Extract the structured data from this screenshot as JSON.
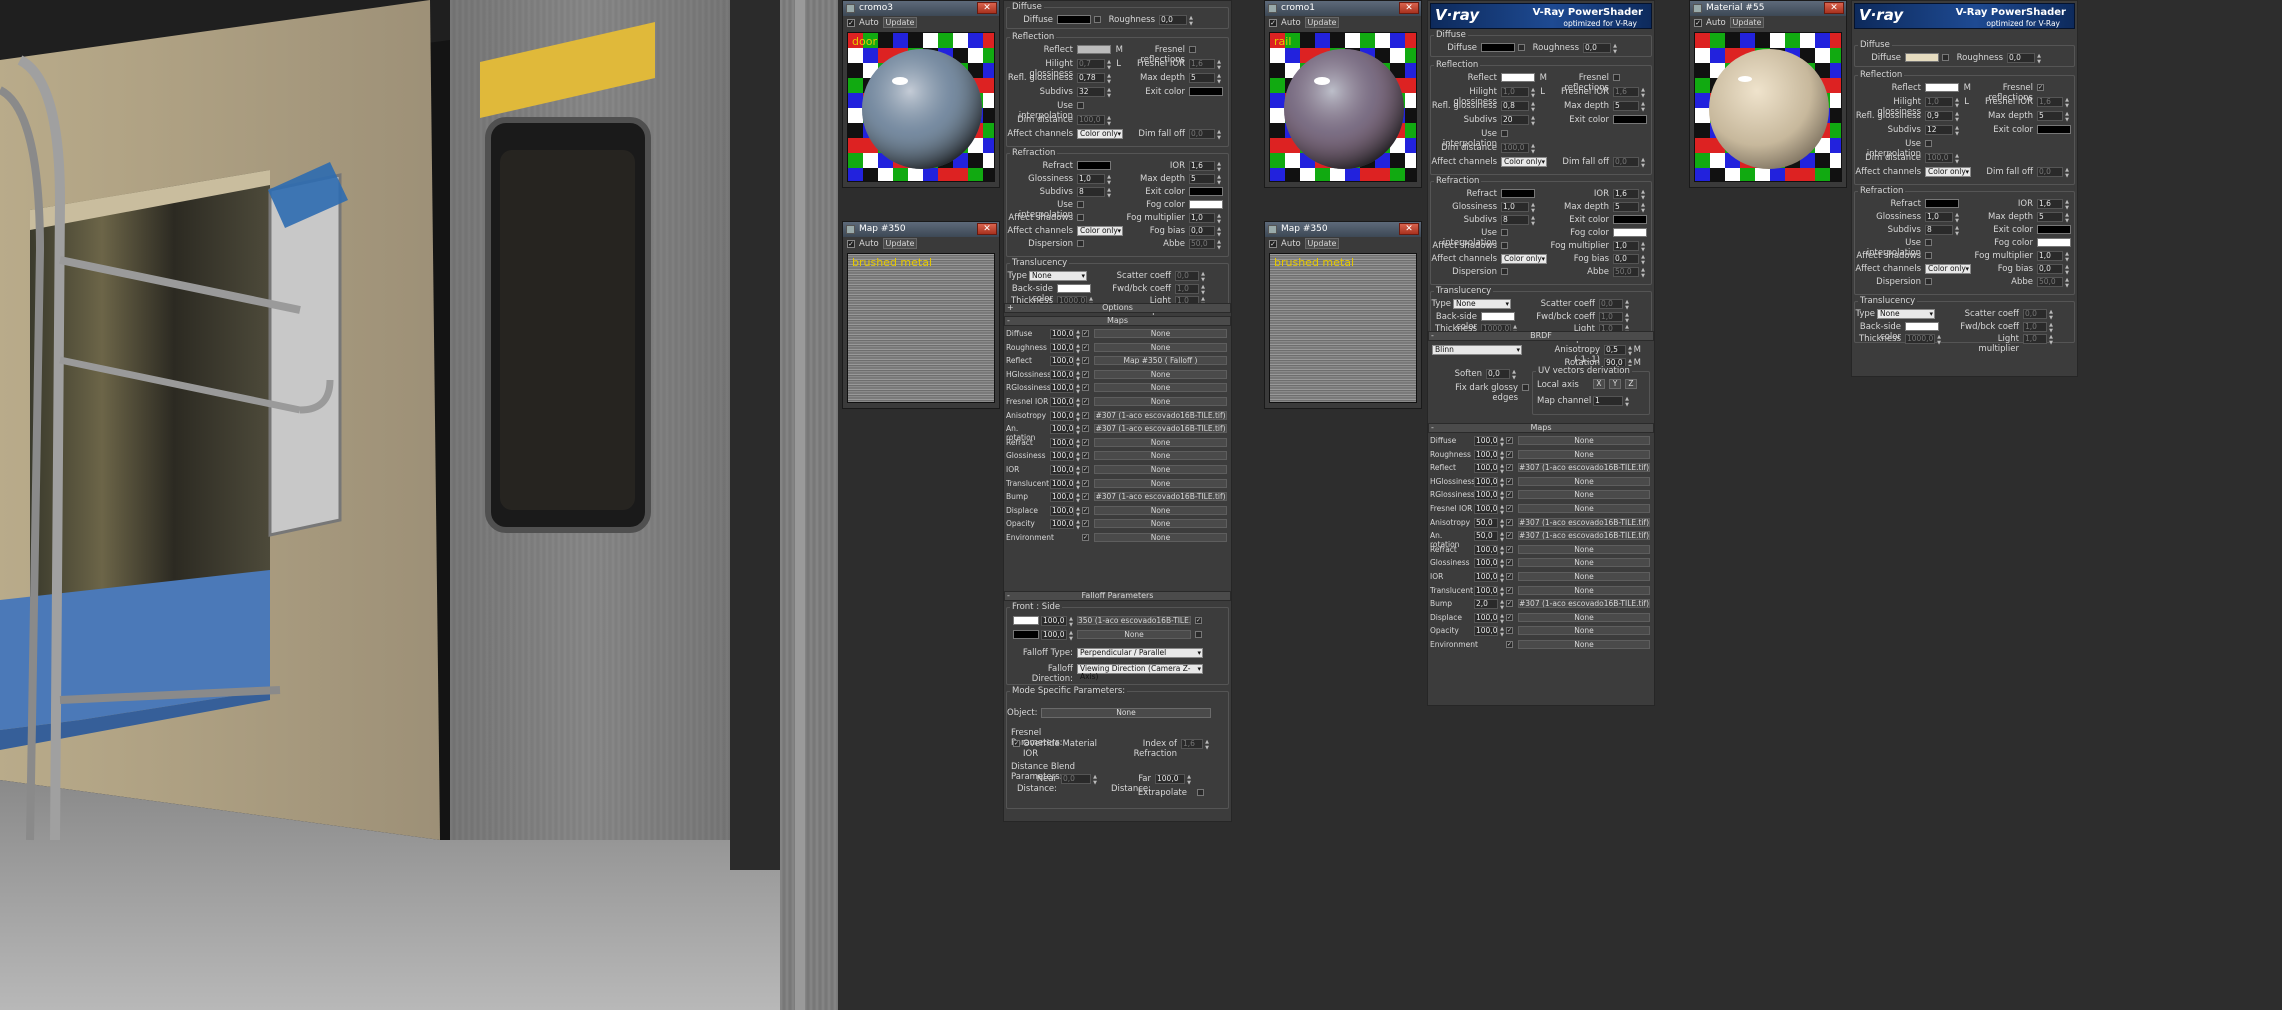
{
  "windows": {
    "cromo3": {
      "title": "cromo3",
      "auto": "Auto",
      "update": "Update",
      "swatch": "door"
    },
    "cromo1": {
      "title": "cromo1",
      "auto": "Auto",
      "update": "Update",
      "swatch": "rail"
    },
    "map350a": {
      "title": "Map #350",
      "auto": "Auto",
      "update": "Update",
      "swatch": "brushed metal"
    },
    "map350b": {
      "title": "Map #350",
      "auto": "Auto",
      "update": "Update",
      "swatch": "brushed metal"
    },
    "material55": {
      "title": "Material #55",
      "auto": "Auto",
      "update": "Update"
    }
  },
  "vray": {
    "logo": "V·ray",
    "title": "V-Ray PowerShader",
    "subtitle": "optimized for V-Ray"
  },
  "labels": {
    "diffuse_sec": "Diffuse",
    "diffuse": "Diffuse",
    "roughness": "Roughness",
    "reflection_sec": "Reflection",
    "reflect": "Reflect",
    "hilight": "Hilight glossiness",
    "refl_gloss": "Refl. glossiness",
    "subdivs": "Subdivs",
    "use_interp": "Use interpolation",
    "dim_distance": "Dim distance",
    "affect_channels": "Affect channels",
    "fresnel_refl": "Fresnel reflections",
    "fresnel_ior": "Fresnel IOR",
    "max_depth": "Max depth",
    "exit_color": "Exit color",
    "dim_falloff": "Dim fall off",
    "L": "L",
    "M": "M",
    "refraction_sec": "Refraction",
    "refract": "Refract",
    "glossiness": "Glossiness",
    "ior": "IOR",
    "fog_color": "Fog color",
    "fog_mult": "Fog multiplier",
    "fog_bias": "Fog bias",
    "affect_shadows": "Affect shadows",
    "dispersion": "Dispersion",
    "abbe": "Abbe",
    "translucency_sec": "Translucency",
    "type": "Type",
    "back_side": "Back-side color",
    "thickness": "Thickness",
    "scatter": "Scatter coeff",
    "fwd_bck": "Fwd/bck coeff",
    "light_mult": "Light multiplier",
    "color_only": "Color only",
    "none": "None",
    "options": "Options",
    "maps": "Maps",
    "brdf": "BRDF",
    "blinn": "Blinn",
    "anisotropy_range": "Anisotropy (-1..1)",
    "rotation": "Rotation",
    "soften": "Soften",
    "fix_dark": "Fix dark glossy edges",
    "uv_deriv": "UV vectors derivation",
    "local_axis": "Local axis",
    "map_channel": "Map channel",
    "x": "X",
    "y": "Y",
    "z": "Z"
  },
  "values": {
    "c3": {
      "roughness": "0,0",
      "hilight": "0,7",
      "fresnel_ior": "1,6",
      "refl_gloss": "0,78",
      "max_depth": "5",
      "subdivs": "32",
      "dim_distance": "100,0",
      "dim_falloff": "0,0",
      "ior": "1,6",
      "glossiness": "1,0",
      "max_depth2": "5",
      "subdivs2": "8",
      "fog_mult": "1,0",
      "fog_bias": "0,0",
      "abbe": "50,0",
      "scatter": "0,0",
      "fwd_bck": "1,0",
      "thickness": "1000,0",
      "light_mult": "1,0"
    },
    "c1": {
      "roughness": "0,0",
      "hilight": "1,0",
      "fresnel_ior": "1,6",
      "refl_gloss": "0,8",
      "max_depth": "5",
      "subdivs": "20",
      "dim_distance": "100,0",
      "dim_falloff": "0,0",
      "ior": "1,6",
      "glossiness": "1,0",
      "max_depth2": "5",
      "subdivs2": "8",
      "fog_mult": "1,0",
      "fog_bias": "0,0",
      "abbe": "50,0",
      "scatter": "0,0",
      "fwd_bck": "1,0",
      "thickness": "1000,0",
      "light_mult": "1,0",
      "anisotropy": "0,5",
      "rotation": "90,0",
      "soften": "0,0",
      "map_channel": "1"
    },
    "m55": {
      "roughness": "0,0",
      "hilight": "1,0",
      "fresnel_ior": "1,6",
      "refl_gloss": "0,9",
      "max_depth": "5",
      "subdivs": "12",
      "dim_distance": "100,0",
      "dim_falloff": "0,0",
      "ior": "1,6",
      "glossiness": "1,0",
      "max_depth2": "5",
      "subdivs2": "8",
      "fog_mult": "1,0",
      "fog_bias": "0,0",
      "abbe": "50,0",
      "scatter": "0,0",
      "fwd_bck": "1,0",
      "thickness": "1000,0",
      "light_mult": "1,0"
    }
  },
  "maps_c3": [
    {
      "name": "Diffuse",
      "amt": "100,0",
      "map": "None"
    },
    {
      "name": "Roughness",
      "amt": "100,0",
      "map": "None"
    },
    {
      "name": "Reflect",
      "amt": "100,0",
      "map": "Map #350  ( Falloff )"
    },
    {
      "name": "HGlossiness",
      "amt": "100,0",
      "map": "None"
    },
    {
      "name": "RGlossiness",
      "amt": "100,0",
      "map": "None"
    },
    {
      "name": "Fresnel IOR",
      "amt": "100,0",
      "map": "None"
    },
    {
      "name": "Anisotropy",
      "amt": "100,0",
      "map": "#307 (1-aco escovado16B-TILE.tif)"
    },
    {
      "name": "An. rotation",
      "amt": "100,0",
      "map": "#307 (1-aco escovado16B-TILE.tif)"
    },
    {
      "name": "Refract",
      "amt": "100,0",
      "map": "None"
    },
    {
      "name": "Glossiness",
      "amt": "100,0",
      "map": "None"
    },
    {
      "name": "IOR",
      "amt": "100,0",
      "map": "None"
    },
    {
      "name": "Translucent",
      "amt": "100,0",
      "map": "None"
    },
    {
      "name": "Bump",
      "amt": "100,0",
      "map": "#307 (1-aco escovado16B-TILE.tif)"
    },
    {
      "name": "Displace",
      "amt": "100,0",
      "map": "None"
    },
    {
      "name": "Opacity",
      "amt": "100,0",
      "map": "None"
    },
    {
      "name": "Environment",
      "amt": "",
      "map": "None"
    }
  ],
  "maps_c1": [
    {
      "name": "Diffuse",
      "amt": "100,0",
      "map": "None"
    },
    {
      "name": "Roughness",
      "amt": "100,0",
      "map": "None"
    },
    {
      "name": "Reflect",
      "amt": "100,0",
      "map": "#307 (1-aco escovado16B-TILE.tif)"
    },
    {
      "name": "HGlossiness",
      "amt": "100,0",
      "map": "None"
    },
    {
      "name": "RGlossiness",
      "amt": "100,0",
      "map": "None"
    },
    {
      "name": "Fresnel IOR",
      "amt": "100,0",
      "map": "None"
    },
    {
      "name": "Anisotropy",
      "amt": "50,0",
      "map": "#307 (1-aco escovado16B-TILE.tif)"
    },
    {
      "name": "An. rotation",
      "amt": "50,0",
      "map": "#307 (1-aco escovado16B-TILE.tif)"
    },
    {
      "name": "Refract",
      "amt": "100,0",
      "map": "None"
    },
    {
      "name": "Glossiness",
      "amt": "100,0",
      "map": "None"
    },
    {
      "name": "IOR",
      "amt": "100,0",
      "map": "None"
    },
    {
      "name": "Translucent",
      "amt": "100,0",
      "map": "None"
    },
    {
      "name": "Bump",
      "amt": "2,0",
      "map": "#307 (1-aco escovado16B-TILE.tif)"
    },
    {
      "name": "Displace",
      "amt": "100,0",
      "map": "None"
    },
    {
      "name": "Opacity",
      "amt": "100,0",
      "map": "None"
    },
    {
      "name": "Environment",
      "amt": "",
      "map": "None"
    }
  ],
  "falloff": {
    "title": "Falloff Parameters",
    "front_side": "Front : Side",
    "v1": "100,0",
    "map1": "350 (1-aco escovado16B-TILE.tif)",
    "v2": "100,0",
    "map2": "None",
    "type_label": "Falloff Type:",
    "type_value": "Perpendicular / Parallel",
    "dir_label": "Falloff Direction:",
    "dir_value": "Viewing Direction (Camera Z-Axis)",
    "mode_title": "Mode Specific Parameters:",
    "object": "Object:",
    "object_value": "None",
    "fresnel_params": "Fresnel Parameters:",
    "override": "Override Material IOR",
    "index_refr": "Index of Refraction",
    "index_value": "1,6",
    "dist_blend": "Distance Blend Parameters:",
    "near": "Near Distance:",
    "near_value": "0,0",
    "far": "Far Distance:",
    "far_value": "100,0",
    "extrapolate": "Extrapolate"
  },
  "colors": {
    "panel": "#3c3c3c",
    "accent": "#e6c900",
    "vray": "#1e4a92"
  }
}
